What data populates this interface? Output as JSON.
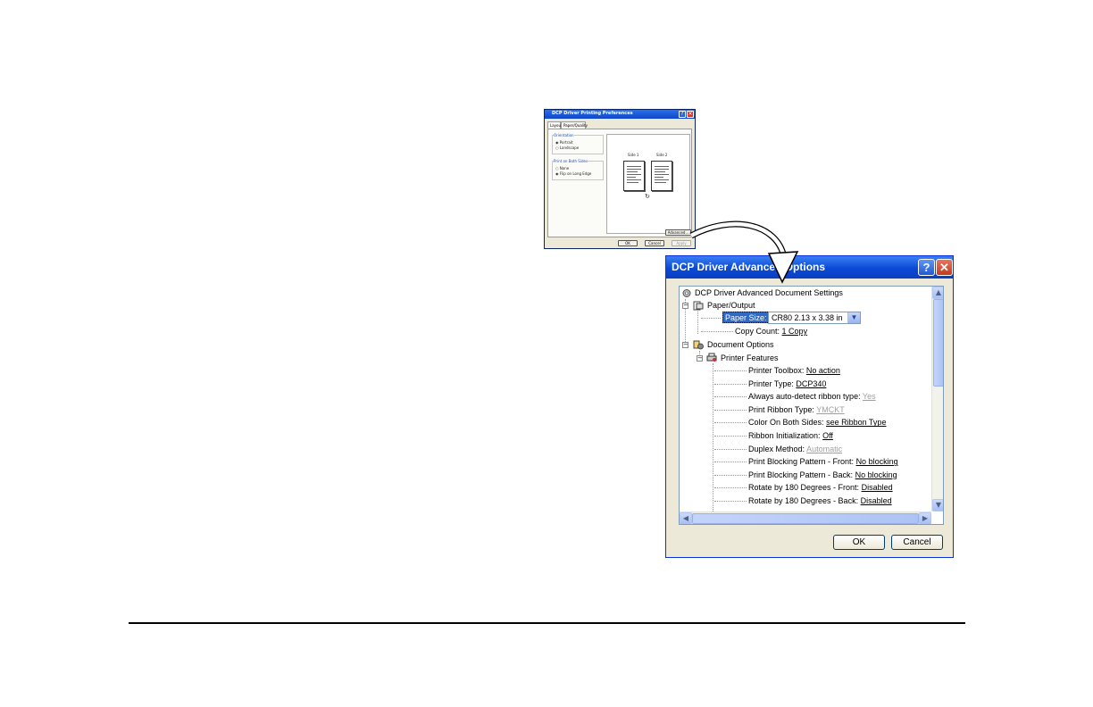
{
  "pref_dialog": {
    "title": "DCP Driver Printing Preferences",
    "tabs": [
      "Layout",
      "Paper/Quality"
    ],
    "orientation": {
      "group_label": "Orientation",
      "options": [
        "Portrait",
        "Landscape"
      ],
      "selected": "Portrait"
    },
    "two_sided": {
      "group_label": "Print on Both Sides",
      "options": [
        "None",
        "Flip on Long Edge"
      ],
      "selected": "Flip on Long Edge"
    },
    "preview": {
      "side1_label": "Side 1",
      "side2_label": "Side 2"
    },
    "advanced_button": "Advanced...",
    "buttons": {
      "ok": "OK",
      "cancel": "Cancel",
      "apply": "Apply"
    }
  },
  "adv_dialog": {
    "title": "DCP Driver Advanced Options",
    "tree": {
      "root": "DCP Driver Advanced Document Settings",
      "paper_output": {
        "label": "Paper/Output",
        "paper_size_label": "Paper Size:",
        "paper_size_value": "CR80 2.13 x 3.38 in",
        "copy_count_label": "Copy Count:",
        "copy_count_value": "1 Copy"
      },
      "document_options": {
        "label": "Document Options"
      },
      "printer_features": {
        "label": "Printer Features",
        "items": [
          {
            "label": "Printer Toolbox:",
            "value": "No action",
            "disabled": false
          },
          {
            "label": "Printer Type:",
            "value": "DCP340",
            "disabled": false
          },
          {
            "label": "Always auto-detect ribbon type:",
            "value": "Yes",
            "disabled": true
          },
          {
            "label": "Print Ribbon Type:",
            "value": "YMCKT",
            "disabled": true
          },
          {
            "label": "Color On Both Sides:",
            "value": "see Ribbon Type",
            "disabled": false
          },
          {
            "label": "Ribbon Initialization:",
            "value": "Off",
            "disabled": false
          },
          {
            "label": "Duplex Method:",
            "value": "Automatic",
            "disabled": true
          },
          {
            "label": "Print Blocking Pattern - Front:",
            "value": "No blocking",
            "disabled": false
          },
          {
            "label": "Print Blocking Pattern - Back:",
            "value": "No blocking",
            "disabled": false
          },
          {
            "label": "Rotate by 180 Degrees - Front:",
            "value": "Disabled",
            "disabled": false
          },
          {
            "label": "Rotate by 180 Degrees - Back:",
            "value": "Disabled",
            "disabled": false
          }
        ]
      }
    },
    "buttons": {
      "ok": "OK",
      "cancel": "Cancel"
    }
  },
  "colors": {
    "title_blue": "#0a49d6",
    "selection": "#316ac5",
    "dialog_bg": "#ece9d8"
  }
}
